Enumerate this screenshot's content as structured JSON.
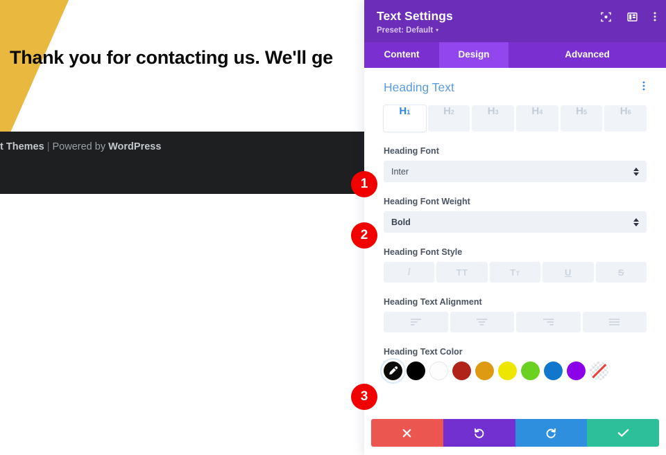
{
  "background": {
    "hero_heading": "Thank you for contacting us. We'll ge",
    "footer": {
      "prefix": "t Themes",
      "separator": "|",
      "powered_by": "Powered by",
      "brand": "WordPress"
    },
    "wedge_color": "#e9b83f",
    "footer_bg": "#1d1f21"
  },
  "modal": {
    "title": "Text Settings",
    "preset_label": "Preset: Default",
    "preset_caret": "▾",
    "header_icons": [
      {
        "name": "focus-target-icon"
      },
      {
        "name": "layout-panel-icon"
      },
      {
        "name": "more-options-icon"
      }
    ],
    "header_bg": "#6c2eb9",
    "tabs": [
      {
        "label": "Content",
        "active": false
      },
      {
        "label": "Design",
        "active": true
      },
      {
        "label": "Advanced",
        "active": false
      }
    ],
    "section": {
      "title": "Heading Text",
      "menu_icon": "section-options-icon"
    },
    "heading_levels": {
      "options": [
        "H1",
        "H2",
        "H3",
        "H4",
        "H5",
        "H6"
      ],
      "letters": [
        "H",
        "H",
        "H",
        "H",
        "H",
        "H"
      ],
      "numbers": [
        "1",
        "2",
        "3",
        "4",
        "5",
        "6"
      ],
      "selected": "H1"
    },
    "fields": {
      "heading_font": {
        "label": "Heading Font",
        "value": "Inter"
      },
      "heading_font_weight": {
        "label": "Heading Font Weight",
        "value": "Bold"
      },
      "heading_font_style": {
        "label": "Heading Font Style",
        "buttons": [
          {
            "name": "italic-icon",
            "glyph": "I"
          },
          {
            "name": "uppercase-icon",
            "glyph": "TT"
          },
          {
            "name": "small-caps-icon",
            "glyph": "T",
            "glyph_small": "T"
          },
          {
            "name": "underline-icon",
            "glyph": "U"
          },
          {
            "name": "strikethrough-icon",
            "glyph": "S"
          }
        ]
      },
      "heading_text_alignment": {
        "label": "Heading Text Alignment",
        "buttons": [
          {
            "name": "align-left-icon"
          },
          {
            "name": "align-center-icon"
          },
          {
            "name": "align-right-icon"
          },
          {
            "name": "align-justify-icon"
          }
        ]
      },
      "heading_text_color": {
        "label": "Heading Text Color",
        "selected": "color-picker",
        "swatches": [
          {
            "name": "color-picker-swatch",
            "color": "#0b0b0b",
            "kind": "picker"
          },
          {
            "name": "swatch-black",
            "color": "#000000",
            "kind": "solid"
          },
          {
            "name": "swatch-white",
            "color": "#fdfdfd",
            "kind": "white"
          },
          {
            "name": "swatch-red",
            "color": "#b02318",
            "kind": "solid"
          },
          {
            "name": "swatch-orange",
            "color": "#dd9a12",
            "kind": "solid"
          },
          {
            "name": "swatch-yellow",
            "color": "#ece600",
            "kind": "solid"
          },
          {
            "name": "swatch-green",
            "color": "#6ad121",
            "kind": "solid"
          },
          {
            "name": "swatch-blue",
            "color": "#1177cc",
            "kind": "solid"
          },
          {
            "name": "swatch-purple",
            "color": "#8c00e8",
            "kind": "solid"
          },
          {
            "name": "swatch-none",
            "color": "transparent",
            "kind": "none"
          }
        ]
      }
    },
    "actions": [
      {
        "name": "discard-button",
        "icon": "close-icon",
        "color": "#ec5651"
      },
      {
        "name": "undo-button",
        "icon": "undo-icon",
        "color": "#7230d1"
      },
      {
        "name": "redo-button",
        "icon": "redo-icon",
        "color": "#2d8fdd"
      },
      {
        "name": "save-button",
        "icon": "check-icon",
        "color": "#2dbf9a"
      }
    ]
  },
  "callouts": [
    {
      "number": "1",
      "target": "heading-font-select"
    },
    {
      "number": "2",
      "target": "heading-font-weight-select"
    },
    {
      "number": "3",
      "target": "heading-text-color-picker"
    }
  ]
}
